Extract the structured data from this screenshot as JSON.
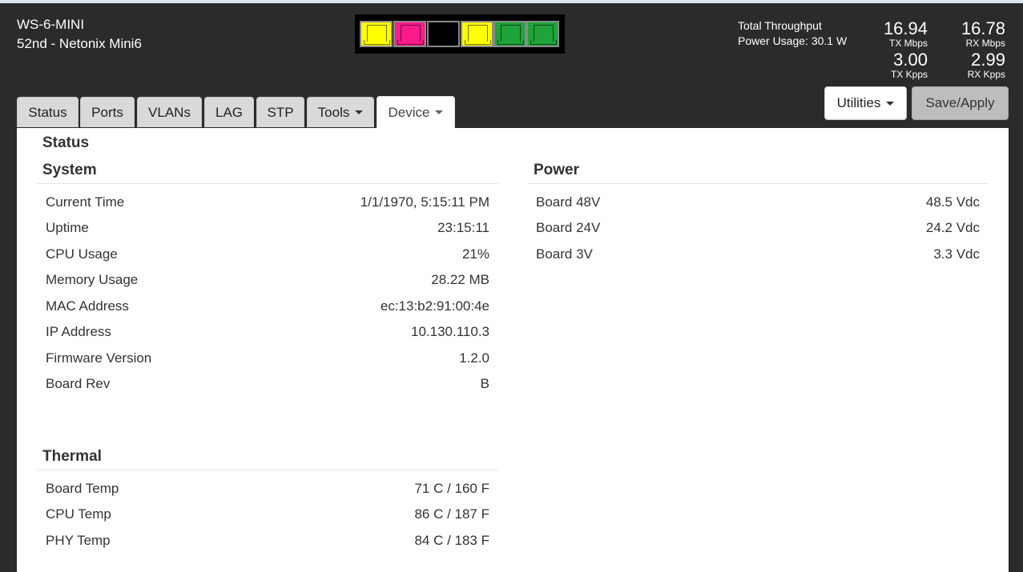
{
  "header": {
    "device_name": "WS-6-MINI",
    "device_desc": "52nd - Netonix Mini6",
    "throughput_label": "Total Throughput",
    "power_usage": "Power Usage: 30.1 W",
    "stats": {
      "tx_mbps": "16.94",
      "tx_mbps_label": "TX Mbps",
      "rx_mbps": "16.78",
      "rx_mbps_label": "RX Mbps",
      "tx_kpps": "3.00",
      "tx_kpps_label": "TX Kpps",
      "rx_kpps": "2.99",
      "rx_kpps_label": "RX Kpps"
    }
  },
  "ports": [
    {
      "color": "#ffff00"
    },
    {
      "color": "#ff1a8c"
    },
    {
      "color": "#000000"
    },
    {
      "color": "#ffff00"
    },
    {
      "color": "#1fa33a"
    },
    {
      "color": "#1fa33a"
    }
  ],
  "tabs": [
    {
      "label": "Status"
    },
    {
      "label": "Ports"
    },
    {
      "label": "VLANs"
    },
    {
      "label": "LAG"
    },
    {
      "label": "STP"
    },
    {
      "label": "Tools"
    },
    {
      "label": "Device"
    }
  ],
  "buttons": {
    "utilities": "Utilities",
    "save_apply": "Save/Apply"
  },
  "page_title": "Status",
  "system": {
    "title": "System",
    "rows": [
      {
        "label": "Current Time",
        "value": "1/1/1970, 5:15:11 PM"
      },
      {
        "label": "Uptime",
        "value": "23:15:11"
      },
      {
        "label": "CPU Usage",
        "value": "21%"
      },
      {
        "label": "Memory Usage",
        "value": "28.22 MB"
      },
      {
        "label": "MAC Address",
        "value": "ec:13:b2:91:00:4e"
      },
      {
        "label": "IP Address",
        "value": "10.130.110.3"
      },
      {
        "label": "Firmware Version",
        "value": "1.2.0"
      },
      {
        "label": "Board Rev",
        "value": "B"
      }
    ]
  },
  "power": {
    "title": "Power",
    "rows": [
      {
        "label": "Board 48V",
        "value": "48.5 Vdc"
      },
      {
        "label": "Board 24V",
        "value": "24.2 Vdc"
      },
      {
        "label": "Board 3V",
        "value": "3.3 Vdc"
      }
    ]
  },
  "thermal": {
    "title": "Thermal",
    "rows": [
      {
        "label": "Board Temp",
        "value": "71 C / 160 F"
      },
      {
        "label": "CPU Temp",
        "value": "86 C / 187 F"
      },
      {
        "label": "PHY Temp",
        "value": "84 C / 183 F"
      }
    ]
  }
}
